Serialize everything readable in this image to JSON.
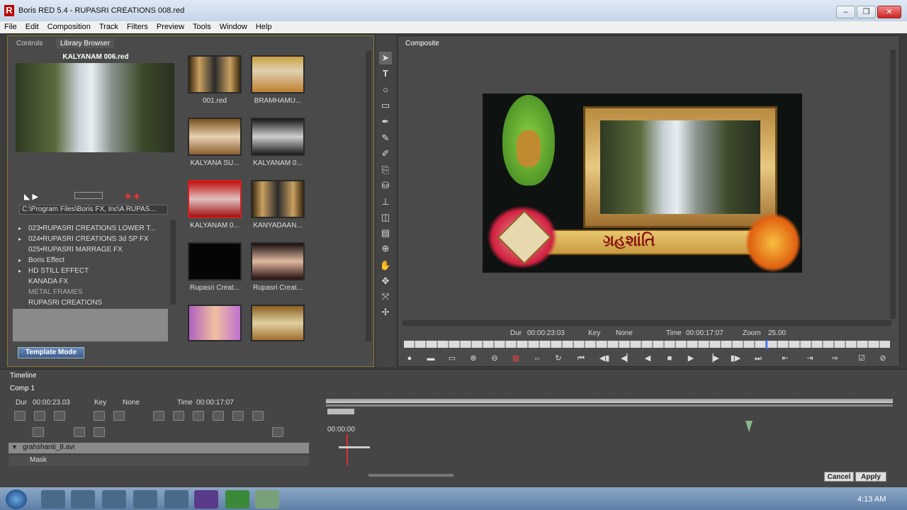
{
  "window": {
    "title": "Boris RED 5.4 - RUPASRI CREATIONS 008.red",
    "logo": "R"
  },
  "menu": [
    "File",
    "Edit",
    "Composition",
    "Track",
    "Filters",
    "Preview",
    "Tools",
    "Window",
    "Help"
  ],
  "left_panel": {
    "tabs": [
      "Controls",
      "Library Browser"
    ],
    "preview_title": "KALYANAM 006.red",
    "path": "C:\\Program Files\\Boris FX, Inc\\A RUPAS...",
    "tree": [
      {
        "label": "023•RUPASRI CREATIONS LOWER T...",
        "arrow": "▸"
      },
      {
        "label": "024•RUPASRI CREATIONS 3d SP FX",
        "arrow": "▸"
      },
      {
        "label": "025•RUPASRI MARRAGE FX",
        "arrow": ""
      },
      {
        "label": "Boris Effect",
        "arrow": "▸"
      },
      {
        "label": "HD STILL EFFECT",
        "arrow": "▸"
      },
      {
        "label": "KANADA FX",
        "arrow": ""
      },
      {
        "label": "METAL FRAMES",
        "arrow": ""
      },
      {
        "label": "RUPASRI CREATIONS",
        "arrow": ""
      }
    ],
    "template_mode": "Template Mode",
    "thumbnails": [
      "001.red",
      "BRAMHAMU...",
      "KALYANA SU...",
      "KALYANAM 0...",
      "KALYANAM 0...",
      "KANYADAAN...",
      "Rupasri Creat...",
      "Rupasri Creat...",
      "",
      ""
    ]
  },
  "composite": {
    "tab": "Composite",
    "dur_label": "Dur",
    "dur": "00:00:23:03",
    "key_label": "Key",
    "key": "None",
    "time_label": "Time",
    "time": "00:00:17:07",
    "zoom_label": "Zoom",
    "zoom": "25.00",
    "overlay_text": "ગ્રહશાંતિ"
  },
  "timeline": {
    "tab": "Timeline",
    "comp": "Comp 1",
    "dur_label": "Dur",
    "dur": "00:00:23.03",
    "key_label": "Key",
    "key": "None",
    "time_label": "Time",
    "time": "00:00:17:07",
    "ruler_start": "00:00:00",
    "tracks": [
      {
        "name": "grahshanti_8.avi"
      },
      {
        "name": "Mask"
      }
    ],
    "cancel": "Cancel",
    "apply": "Apply"
  },
  "taskbar": {
    "clock": "4:13 AM"
  },
  "colors": {
    "accent": "#c8a800",
    "playhead": "#e03030",
    "taskbar": "#6f8fb5"
  }
}
